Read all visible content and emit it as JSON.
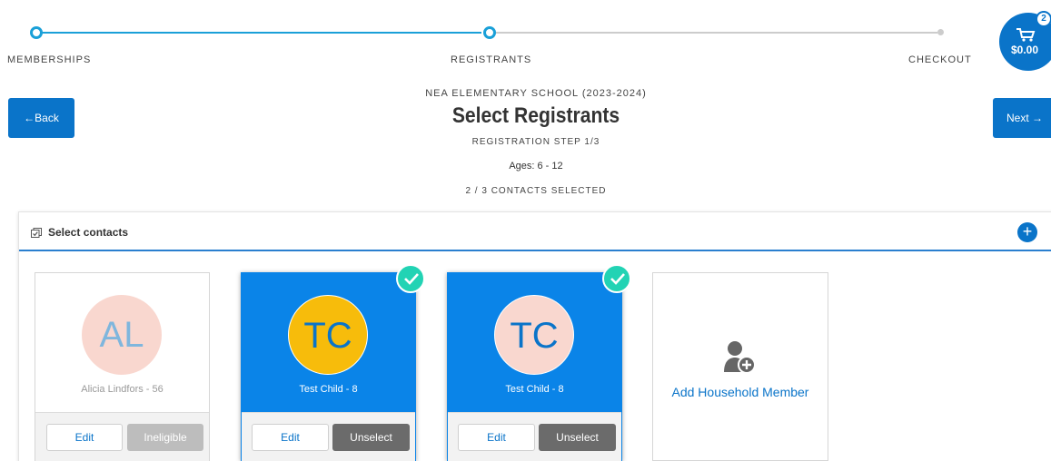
{
  "stepper": {
    "steps": [
      {
        "label": "MEMBERSHIPS",
        "state": "complete"
      },
      {
        "label": "REGISTRANTS",
        "state": "current"
      },
      {
        "label": "CHECKOUT",
        "state": "upcoming"
      }
    ],
    "active_color": "#1aa0d8",
    "inactive_color": "#cccccc"
  },
  "cart": {
    "item_count": "2",
    "total": "$0.00",
    "icon": "cart-icon"
  },
  "nav": {
    "back_label": "←Back",
    "next_label": "Next →"
  },
  "header": {
    "school": "NEA ELEMENTARY SCHOOL (2023-2024)",
    "title": "Select Registrants",
    "step": "REGISTRATION STEP 1/3",
    "ages": "Ages: 6 - 12",
    "selected_count": "2 / 3 CONTACTS SELECTED"
  },
  "panel": {
    "title": "Select contacts",
    "icon": "checkbox-list-icon",
    "add_icon": "plus-icon"
  },
  "contacts": [
    {
      "initials": "AL",
      "name": "Alicia Lindfors - 56",
      "selected": false,
      "avatar_bg": "#f9d7cf",
      "initials_color": "#7fb6dd",
      "edit_label": "Edit",
      "action_label": "Ineligible"
    },
    {
      "initials": "TC",
      "name": "Test Child - 8",
      "selected": true,
      "avatar_bg": "#f7bc0b",
      "initials_color": "#0a74c9",
      "edit_label": "Edit",
      "action_label": "Unselect"
    },
    {
      "initials": "TC",
      "name": "Test Child - 8",
      "selected": true,
      "avatar_bg": "#f9d7cf",
      "initials_color": "#0a74c9",
      "edit_label": "Edit",
      "action_label": "Unselect"
    }
  ],
  "add_member": {
    "label": "Add Household Member",
    "icon": "add-user-icon"
  },
  "colors": {
    "primary": "#0a74c9",
    "selected_card": "#0a84e8",
    "check": "#22d3b4"
  }
}
